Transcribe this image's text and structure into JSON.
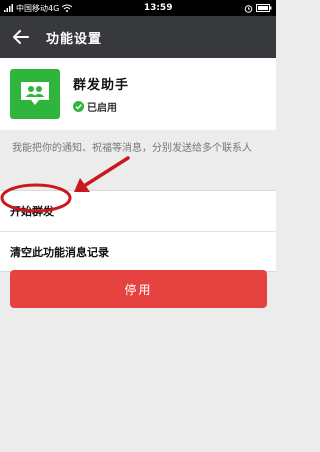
{
  "status_bar": {
    "carrier": "中国移动4G",
    "time": "13:59"
  },
  "header": {
    "title": "功能设置"
  },
  "app": {
    "name": "群发助手",
    "status": "已启用"
  },
  "description": "我能把你的通知、祝福等消息，分别发送给多个联系人",
  "menu": {
    "items": [
      {
        "label": "开始群发"
      },
      {
        "label": "清空此功能消息记录"
      }
    ]
  },
  "disable_button": {
    "label": "停用"
  },
  "colors": {
    "header_bg": "#38393d",
    "accent_green": "#2fb53b",
    "danger_red": "#e64340",
    "annotation_red": "#c8191f"
  }
}
